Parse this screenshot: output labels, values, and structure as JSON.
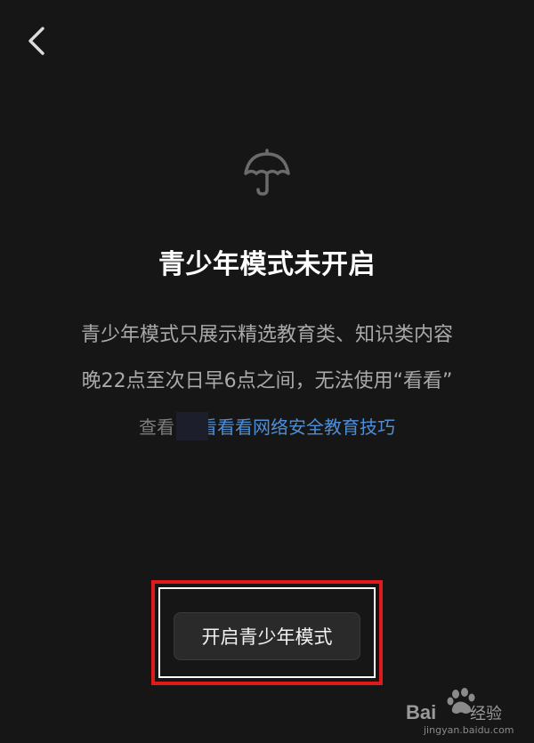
{
  "nav": {
    "back_icon": "chevron-left-icon"
  },
  "hero": {
    "icon": "umbrella-icon",
    "title": "青少年模式未开启",
    "desc_line1": "青少年模式只展示精选教育类、知识类内容",
    "desc_line2": "晚22点至次日早6点之间，无法使用“看看”"
  },
  "link": {
    "prefix": "查看",
    "text": "钱看看看网络安全教育技巧"
  },
  "action": {
    "enable_label": "开启青少年模式"
  },
  "watermark": {
    "brand": "Bai经验",
    "url": "jingyan.baidu.com"
  },
  "colors": {
    "background": "#161616",
    "link": "#4e8ed6",
    "highlight": "#e01a1a"
  }
}
